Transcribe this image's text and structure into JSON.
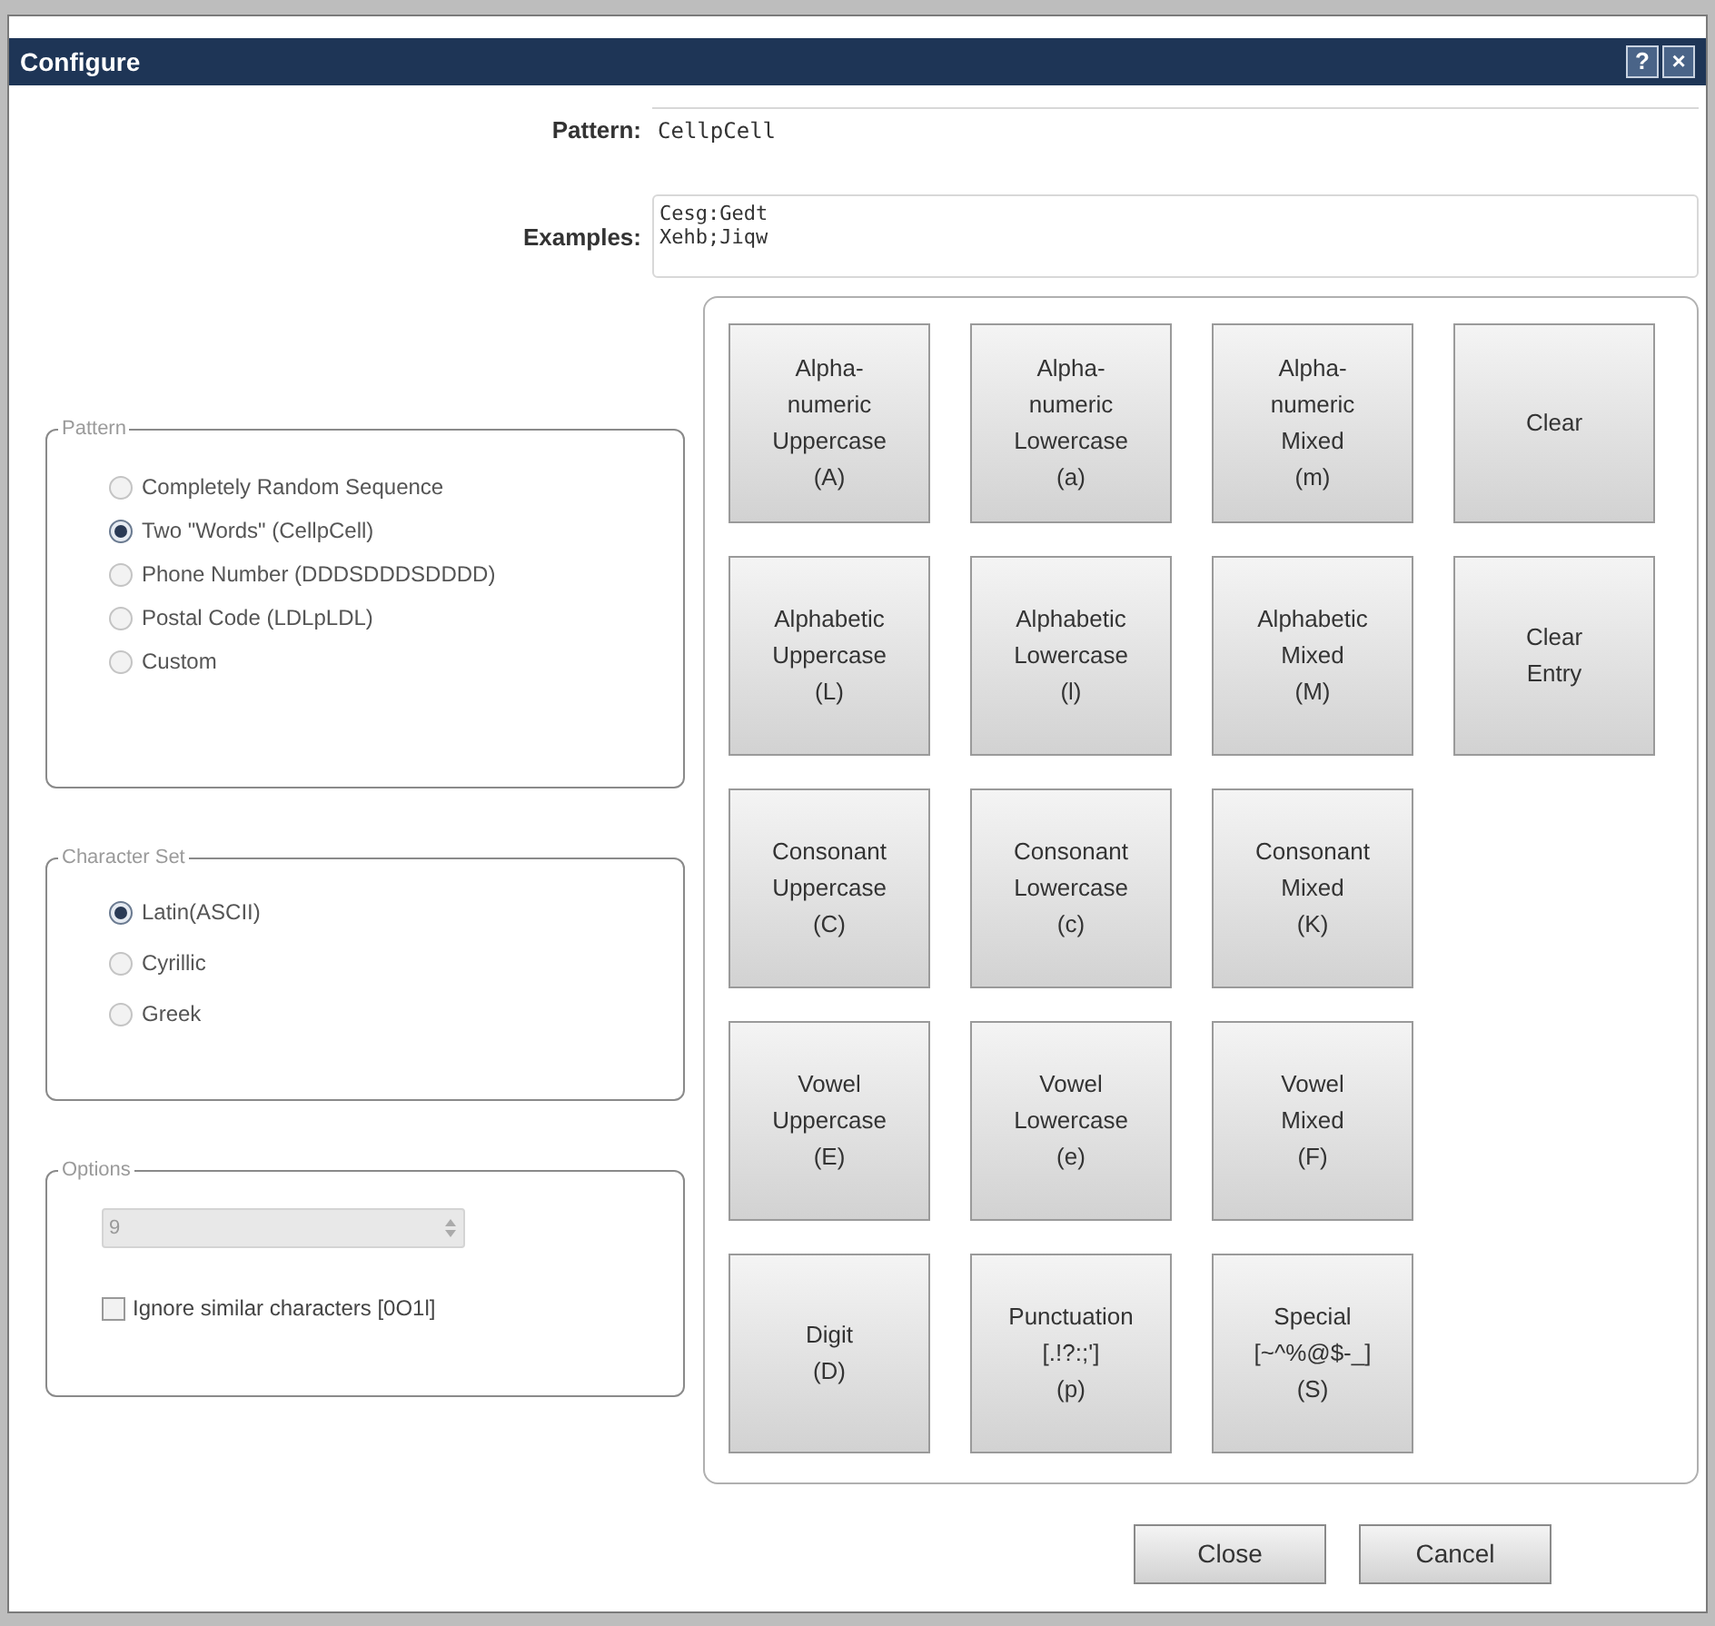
{
  "window": {
    "title": "Configure",
    "title_buttons": [
      "?",
      "×"
    ]
  },
  "pattern": {
    "label": "Pattern:",
    "value": "CellpCell"
  },
  "examples": {
    "label": "Examples:",
    "lines": [
      "Cesg:Gedt",
      "Xehb;Jiqw"
    ]
  },
  "pattern_group": {
    "legend": "Pattern",
    "options": [
      {
        "label": "Completely Random Sequence",
        "selected": false
      },
      {
        "label": "Two \"Words\" (CellpCell)",
        "selected": true
      },
      {
        "label": "Phone Number (DDDSDDDSDDDD)",
        "selected": false
      },
      {
        "label": "Postal Code (LDLpLDL)",
        "selected": false
      },
      {
        "label": "Custom",
        "selected": false
      }
    ]
  },
  "character_set": {
    "legend": "Character Set",
    "options": [
      {
        "label": "Latin(ASCII)",
        "selected": true
      },
      {
        "label": "Cyrillic",
        "selected": false
      },
      {
        "label": "Greek",
        "selected": false
      }
    ]
  },
  "options": {
    "legend": "Options",
    "length": {
      "value": "9",
      "disabled": true
    },
    "ignore_similar": {
      "label": "Ignore similar characters [0O1l]",
      "checked": false
    }
  },
  "token_rows": [
    [
      {
        "lines": [
          "Alpha-",
          "numeric",
          "Uppercase",
          "(A)"
        ]
      },
      {
        "lines": [
          "Alpha-",
          "numeric",
          "Lowercase",
          "(a)"
        ]
      },
      {
        "lines": [
          "Alpha-",
          "numeric",
          "Mixed",
          "(m)"
        ]
      },
      {
        "lines": [
          "Clear"
        ]
      }
    ],
    [
      {
        "lines": [
          "Alphabetic",
          "Uppercase",
          "(L)"
        ]
      },
      {
        "lines": [
          "Alphabetic",
          "Lowercase",
          "(l)"
        ]
      },
      {
        "lines": [
          "Alphabetic",
          "Mixed",
          "(M)"
        ]
      },
      {
        "lines": [
          "Clear",
          "Entry"
        ]
      }
    ],
    [
      {
        "lines": [
          "Consonant",
          "Uppercase",
          "(C)"
        ]
      },
      {
        "lines": [
          "Consonant",
          "Lowercase",
          "(c)"
        ]
      },
      {
        "lines": [
          "Consonant",
          "Mixed",
          "(K)"
        ]
      }
    ],
    [
      {
        "lines": [
          "Vowel",
          "Uppercase",
          "(E)"
        ]
      },
      {
        "lines": [
          "Vowel",
          "Lowercase",
          "(e)"
        ]
      },
      {
        "lines": [
          "Vowel",
          "Mixed",
          "(F)"
        ]
      }
    ],
    [
      {
        "lines": [
          "Digit",
          "(D)"
        ]
      },
      {
        "lines": [
          "Punctuation",
          "[.!?:;']",
          "(p)"
        ]
      },
      {
        "lines": [
          "Special",
          "[~^%@$-_]",
          "(S)"
        ]
      }
    ]
  ],
  "footer_buttons": [
    "Close",
    "Cancel"
  ]
}
